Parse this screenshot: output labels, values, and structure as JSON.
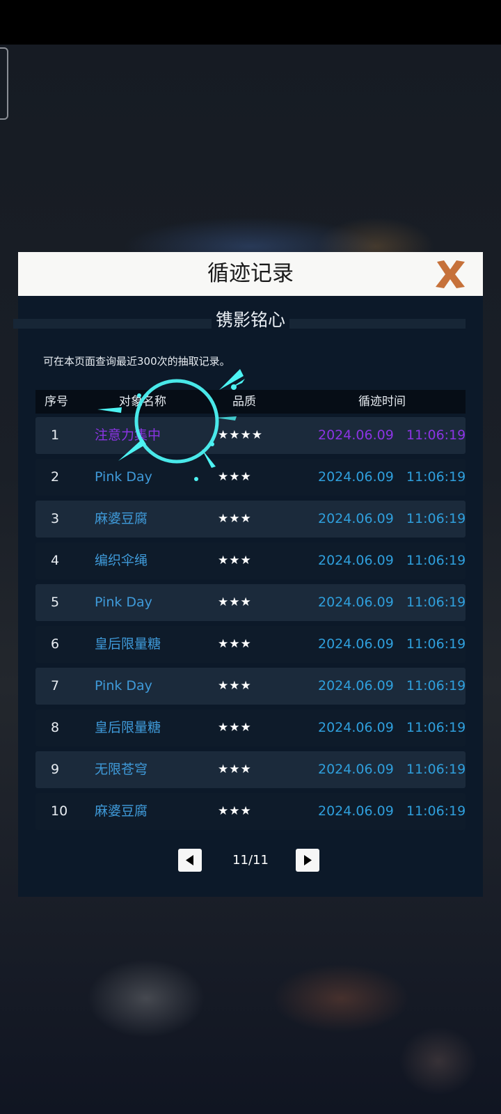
{
  "dialog": {
    "title": "循迹记录",
    "subtitle": "镌影铭心",
    "hint": "可在本页面查询最近300次的抽取记录。",
    "columns": [
      "序号",
      "对象名称",
      "品质",
      "循迹时间"
    ],
    "rows": [
      {
        "idx": "1",
        "name": "注意力集中",
        "stars": "★★★★",
        "time": "2024.06.09   11:06:19",
        "color": "#8b34e4"
      },
      {
        "idx": "2",
        "name": "Pink Day",
        "stars": "★★★",
        "time": "2024.06.09   11:06:19"
      },
      {
        "idx": "3",
        "name": "麻婆豆腐",
        "stars": "★★★",
        "time": "2024.06.09   11:06:19"
      },
      {
        "idx": "4",
        "name": "编织伞绳",
        "stars": "★★★",
        "time": "2024.06.09   11:06:19"
      },
      {
        "idx": "5",
        "name": "Pink Day",
        "stars": "★★★",
        "time": "2024.06.09   11:06:19"
      },
      {
        "idx": "6",
        "name": "皇后限量糖",
        "stars": "★★★",
        "time": "2024.06.09   11:06:19"
      },
      {
        "idx": "7",
        "name": "Pink Day",
        "stars": "★★★",
        "time": "2024.06.09   11:06:19"
      },
      {
        "idx": "8",
        "name": "皇后限量糖",
        "stars": "★★★",
        "time": "2024.06.09   11:06:19"
      },
      {
        "idx": "9",
        "name": "无限苍穹",
        "stars": "★★★",
        "time": "2024.06.09   11:06:19"
      },
      {
        "idx": "10",
        "name": "麻婆豆腐",
        "stars": "★★★",
        "time": "2024.06.09   11:06:19"
      }
    ],
    "pager": {
      "text": "11/11",
      "prev_icon": "triangle-left-icon",
      "next_icon": "triangle-right-icon"
    }
  },
  "colors": {
    "accent_blue": "#2f9fdc",
    "rare_purple": "#8b34e4",
    "close_orange": "#c6713a",
    "effect_cyan": "#4df3f3"
  }
}
